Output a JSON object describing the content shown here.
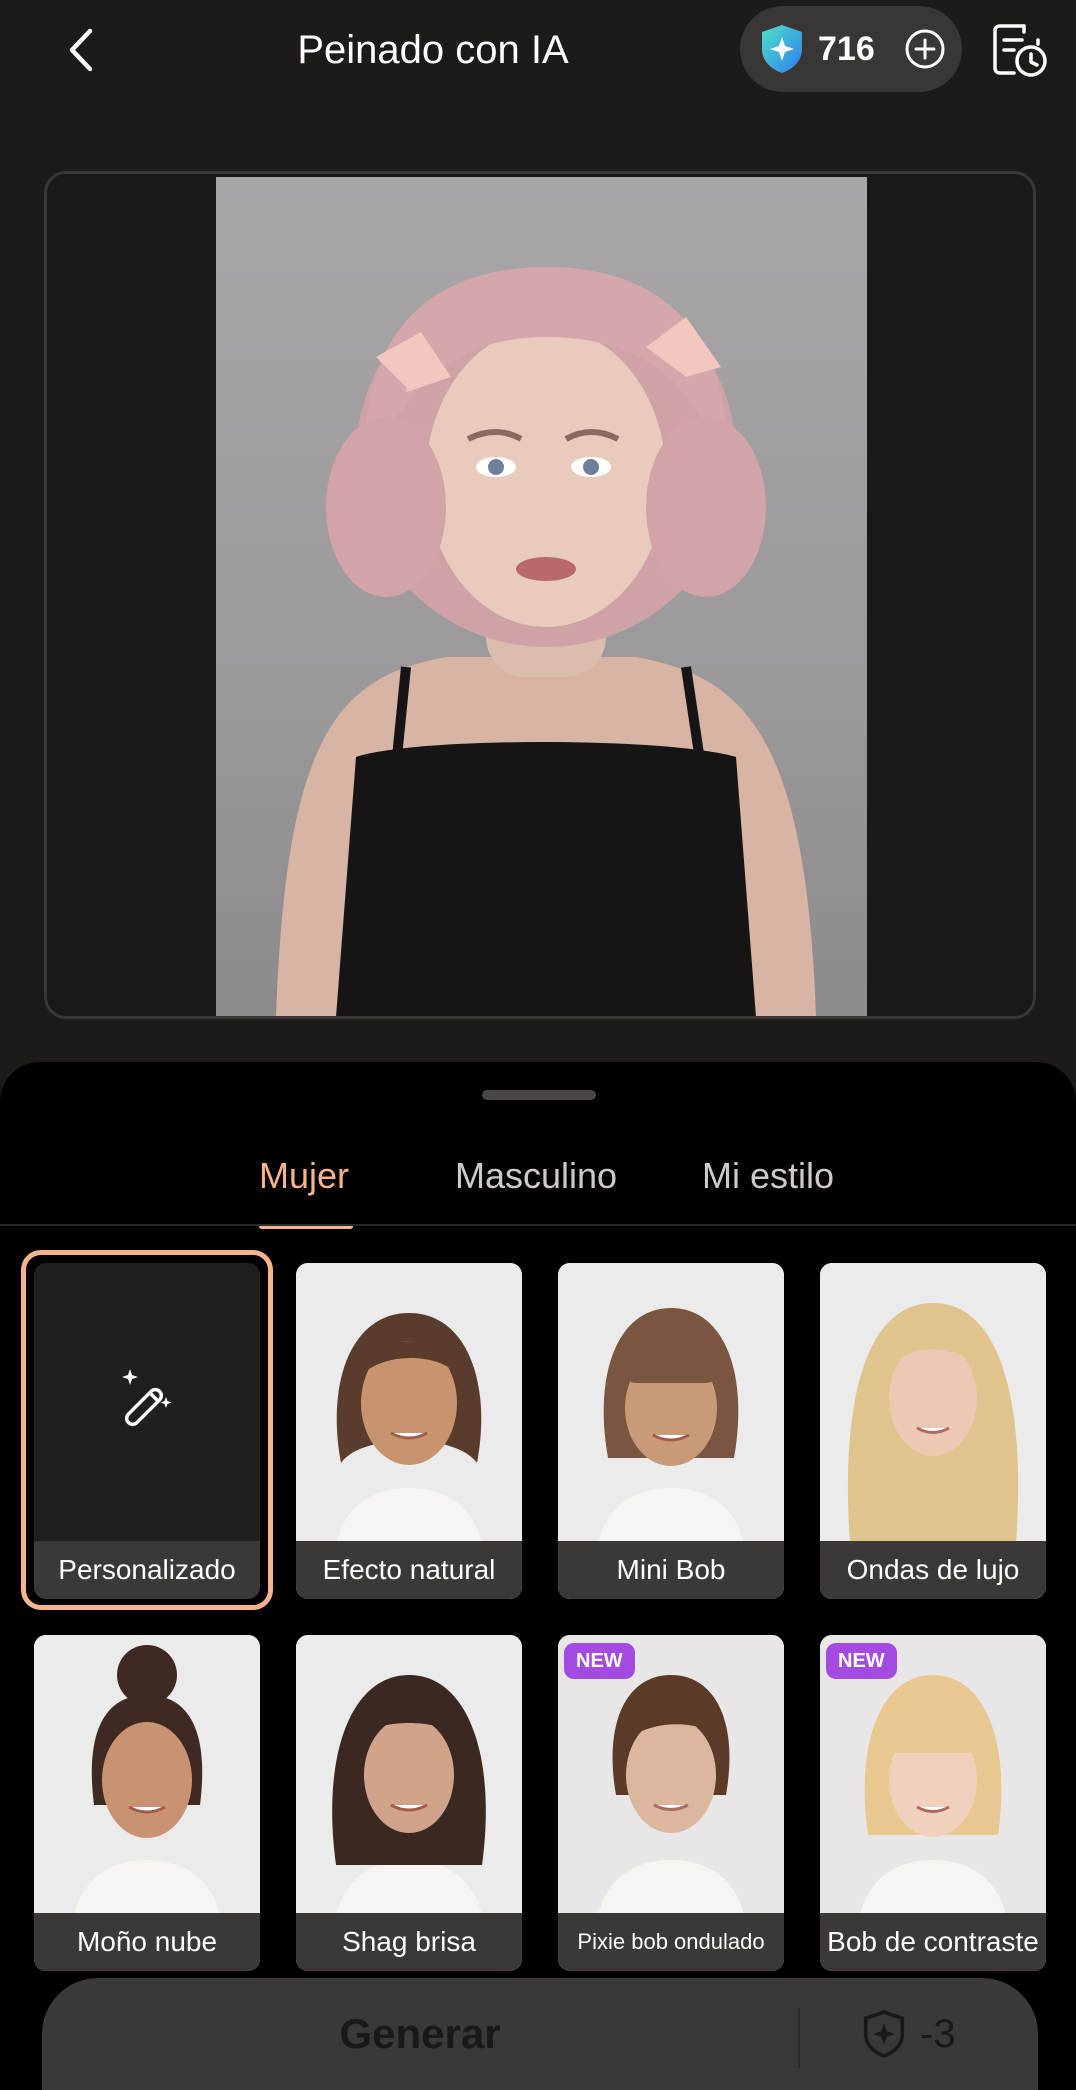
{
  "header": {
    "title": "Peinado con IA",
    "credits": "716"
  },
  "tabs": [
    {
      "label": "Mujer",
      "active": true
    },
    {
      "label": "Masculino",
      "active": false
    },
    {
      "label": "Mi estilo",
      "active": false
    }
  ],
  "styles": [
    {
      "label": "Personalizado",
      "selected": true,
      "new": false
    },
    {
      "label": "Efecto natural",
      "selected": false,
      "new": false
    },
    {
      "label": "Mini Bob",
      "selected": false,
      "new": false
    },
    {
      "label": "Ondas de lujo",
      "selected": false,
      "new": false
    },
    {
      "label": "Moño nube",
      "selected": false,
      "new": false
    },
    {
      "label": "Shag brisa",
      "selected": false,
      "new": false
    },
    {
      "label": "Pixie bob ondulado",
      "selected": false,
      "new": true
    },
    {
      "label": "Bob de contraste",
      "selected": false,
      "new": true
    }
  ],
  "badge_text": "NEW",
  "generate": {
    "label": "Generar",
    "cost": "-3"
  },
  "colors": {
    "accent": "#f7b48c",
    "badge": "#a34be0",
    "background": "#1e1a19"
  },
  "icons": {
    "back": "chevron-left-icon",
    "credits": "shield-star-icon",
    "add": "plus-circle-icon",
    "history": "history-icon",
    "custom": "magic-wand-icon",
    "cost": "shield-star-icon"
  }
}
